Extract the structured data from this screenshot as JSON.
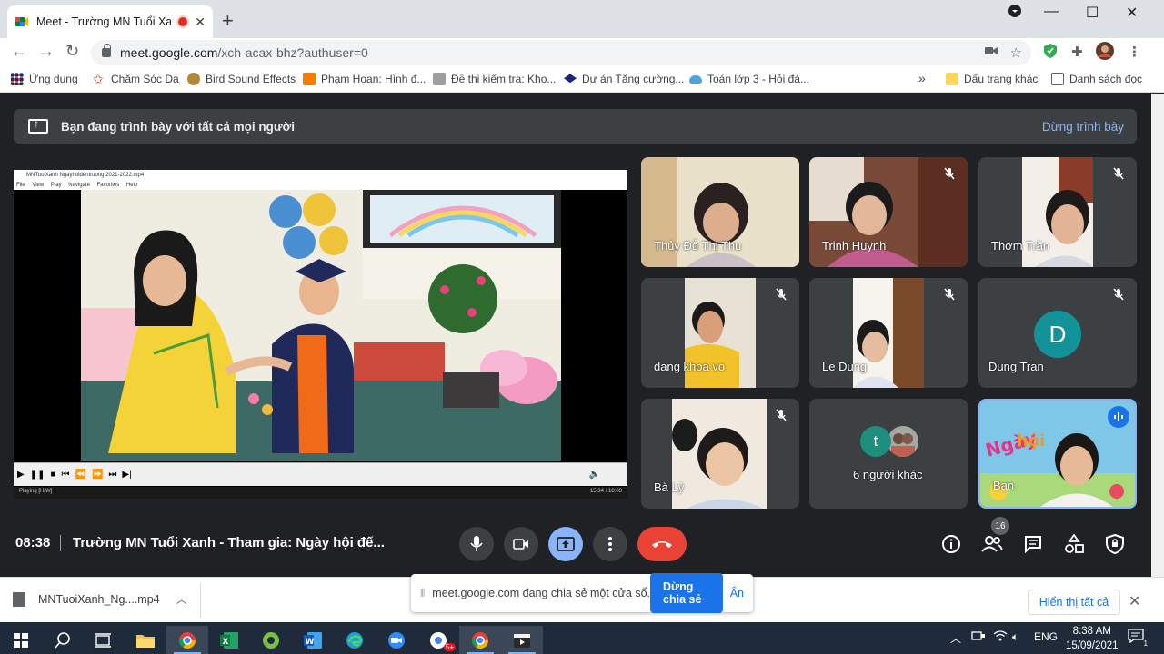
{
  "browser": {
    "tab_title": "Meet - Trường MN Tuổi Xanh",
    "url_host": "meet.google.com",
    "url_path": "/xch-acax-bhz?authuser=0"
  },
  "bookmarks": {
    "items": [
      {
        "label": "Ứng dụng"
      },
      {
        "label": "Chăm Sóc Da"
      },
      {
        "label": "Bird Sound Effects"
      },
      {
        "label": "Phạm Hoan: Hình đ..."
      },
      {
        "label": "Đề thi kiểm tra: Kho..."
      },
      {
        "label": "Dự án Tăng cường..."
      },
      {
        "label": "Toán lớp 3 - Hỏi đá..."
      }
    ],
    "other_label": "Dấu trang khác",
    "reading_list": "Danh sách đọc"
  },
  "meet": {
    "presenting_text": "Bạn đang trình bày với tất cả mọi người",
    "stop_presenting": "Dừng trình bày",
    "presented_window": {
      "title": "MNTuoiXanh Ngayhoidentruong 2021-2022.mp4",
      "menu": "File View Play Navigate Favorites Help",
      "status_left": "Playing [H/W]",
      "status_right": "15:34 / 18:03"
    },
    "participants": [
      {
        "name": "Thủy Đỗ Thị Thu"
      },
      {
        "name": "Trinh Huynh"
      },
      {
        "name": "Thơm Trần"
      },
      {
        "name": "dang khoa vo"
      },
      {
        "name": "Le Dung"
      },
      {
        "name": "Dung Tran",
        "initial": "D"
      },
      {
        "name": "Bà Lý"
      },
      {
        "name": "6 người khác",
        "initial": "t"
      },
      {
        "name": "Bạn"
      }
    ],
    "clock": "08:38",
    "meeting_title": "Trường MN Tuổi Xanh - Tham gia: Ngày hội đế...",
    "participant_count": "16"
  },
  "download_shelf": {
    "file_name": "MNTuoiXanh_Ng....mp4",
    "share_text": "meet.google.com đang chia sẻ một cửa sổ.",
    "stop_share": "Dừng chia sẻ",
    "hide": "Ẩn",
    "show_all": "Hiển thị tất cả"
  },
  "taskbar": {
    "chrome_badge": "5+",
    "lang": "ENG",
    "time": "8:38 AM",
    "date": "15/09/2021",
    "notif_count": "1"
  },
  "colors": {
    "meet_bg": "#202124",
    "tile_bg": "#3c4043",
    "accent_blue": "#8ab4f8",
    "hangup_red": "#ea4335",
    "share_blue": "#1a73e8"
  }
}
